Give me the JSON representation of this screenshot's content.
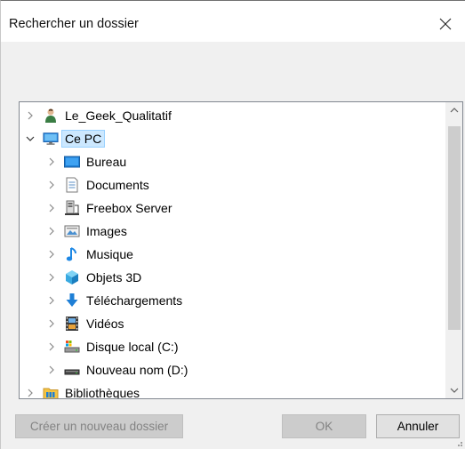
{
  "dialog": {
    "title": "Rechercher un dossier",
    "close_icon": "close-icon"
  },
  "tree": {
    "items": [
      {
        "label": "Le_Geek_Qualitatif",
        "icon": "user-folder-icon",
        "level": 0,
        "expanded": false
      },
      {
        "label": "Ce PC",
        "icon": "computer-icon",
        "level": 0,
        "expanded": true,
        "selected": true
      },
      {
        "label": "Bureau",
        "icon": "desktop-icon",
        "level": 1,
        "expanded": false
      },
      {
        "label": "Documents",
        "icon": "documents-icon",
        "level": 1,
        "expanded": false
      },
      {
        "label": "Freebox Server",
        "icon": "network-drive-icon",
        "level": 1,
        "expanded": false
      },
      {
        "label": "Images",
        "icon": "images-icon",
        "level": 1,
        "expanded": false
      },
      {
        "label": "Musique",
        "icon": "music-icon",
        "level": 1,
        "expanded": false
      },
      {
        "label": "Objets 3D",
        "icon": "cube-icon",
        "level": 1,
        "expanded": false
      },
      {
        "label": "Téléchargements",
        "icon": "download-icon",
        "level": 1,
        "expanded": false
      },
      {
        "label": "Vidéos",
        "icon": "video-icon",
        "level": 1,
        "expanded": false
      },
      {
        "label": "Disque local (C:)",
        "icon": "local-disk-icon",
        "level": 1,
        "expanded": false
      },
      {
        "label": "Nouveau nom (D:)",
        "icon": "drive-icon",
        "level": 1,
        "expanded": false
      },
      {
        "label": "Bibliothèques",
        "icon": "libraries-icon",
        "level": 0,
        "expanded": false
      }
    ]
  },
  "buttons": {
    "new_folder": "Créer un nouveau dossier",
    "ok": "OK",
    "cancel": "Annuler"
  },
  "colors": {
    "selection": "#cce8ff",
    "selection_border": "#99d1ff",
    "accent": "#0078d7"
  }
}
